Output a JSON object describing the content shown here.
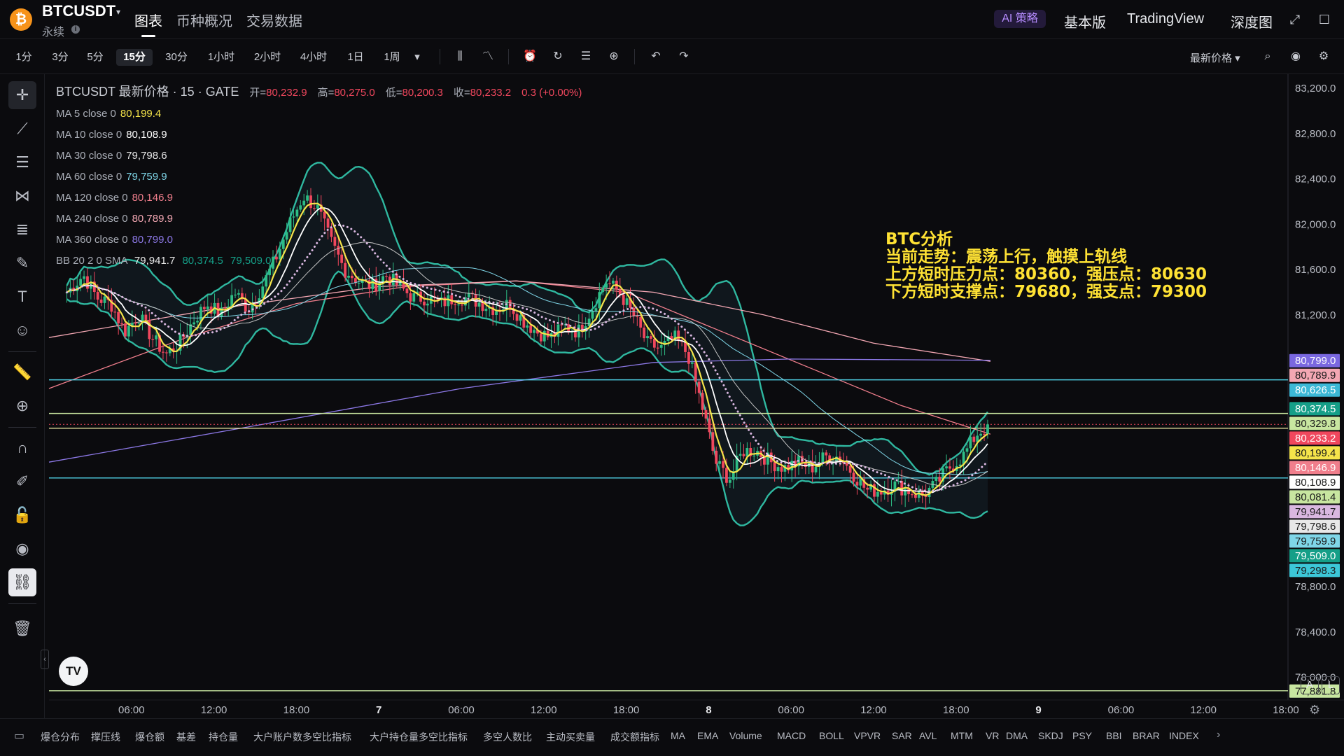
{
  "header": {
    "logo_glyph": "₿",
    "symbol": "BTCUSDT",
    "symbol_caret": "▾",
    "subtitle": "永续",
    "info_glyph": "i",
    "main_tabs": [
      "图表",
      "币种概况",
      "交易数据"
    ],
    "ai_badge": "AI 策略",
    "right_tabs": [
      "基本版",
      "TradingView",
      "深度图"
    ],
    "icons": [
      "expand-icon",
      "fullscreen-icon"
    ]
  },
  "toolbar": {
    "intervals": [
      "1分",
      "3分",
      "5分",
      "15分",
      "30分",
      "1小时",
      "2小时",
      "4小时",
      "1日",
      "1周"
    ],
    "active_interval": "15分",
    "dropdown_glyph": "▾",
    "price_mode": "最新价格 ▾",
    "icons": [
      "candle-type-icon",
      "indicators-icon",
      "alert-icon",
      "replay-icon",
      "templates-icon",
      "add-icon",
      "undo-icon",
      "redo-icon",
      "search-icon",
      "camera-icon",
      "settings-icon"
    ]
  },
  "rail": {
    "tools": [
      "crosshair-icon",
      "trendline-icon",
      "fib-icon",
      "pattern-icon",
      "gann-icon",
      "brush-icon",
      "text-icon",
      "emoji-icon",
      "ruler-icon",
      "zoom-icon",
      "magnet-icon",
      "draw-lock-icon",
      "lock-icon",
      "eye-icon",
      "link-icon",
      "trash-icon"
    ]
  },
  "legend": {
    "title": "BTCUSDT 最新价格 · 15 · GATE",
    "ohlc": [
      {
        "label": "开=",
        "value": "80,232.9"
      },
      {
        "label": "高=",
        "value": "80,275.0"
      },
      {
        "label": "低=",
        "value": "80,200.3"
      },
      {
        "label": "收=",
        "value": "80,233.2"
      }
    ],
    "change": "0.3 (+0.00%)",
    "ma": [
      {
        "label": "MA 5 close 0",
        "value": "80,199.4",
        "color": "#f5e44a"
      },
      {
        "label": "MA 10 close 0",
        "value": "80,108.9",
        "color": "#ffffff"
      },
      {
        "label": "MA 30 close 0",
        "value": "79,798.6",
        "color": "#e8e8e8"
      },
      {
        "label": "MA 60 close 0",
        "value": "79,759.9",
        "color": "#7fd6e8"
      },
      {
        "label": "MA 120 close 0",
        "value": "80,146.9",
        "color": "#f07e8c"
      },
      {
        "label": "MA 240 close 0",
        "value": "80,789.9",
        "color": "#f3a7b3"
      },
      {
        "label": "MA 360 close 0",
        "value": "80,799.0",
        "color": "#8c78e6"
      }
    ],
    "bb": {
      "label": "BB 20 2 0 SMA",
      "values": [
        "79,941.7",
        "80,374.5",
        "79,509.0"
      ]
    }
  },
  "annotation": {
    "lines": [
      "BTC分析",
      "当前走势：震荡上行，触摸上轨线",
      "上方短时压力点：80360，强压点：80630",
      "下方短时支撑点：79680，强支点：79300"
    ]
  },
  "chart_data": {
    "type": "candlestick",
    "title": "BTCUSDT 最新价格 · 15 · GATE",
    "ylim": [
      77800,
      83300
    ],
    "y_ticks": [
      83200,
      82800,
      82400,
      82000,
      81600,
      81200,
      80800,
      80400,
      80000,
      79600,
      79200,
      78800,
      78400,
      78000
    ],
    "y_tick_labels": [
      "83,200.0",
      "82,800.0",
      "82,400.0",
      "82,000.0",
      "81,600.0",
      "81,200.0",
      "80,800.0",
      "80,400.0",
      "80,000.0",
      "79,600.0",
      "79,200.0",
      "78,800.0",
      "78,400.0",
      "78,000.0"
    ],
    "x_ticks": [
      {
        "t": 6,
        "label": "06:00"
      },
      {
        "t": 12,
        "label": "12:00"
      },
      {
        "t": 18,
        "label": "18:00"
      },
      {
        "t": 24,
        "label": "7",
        "bold": true
      },
      {
        "t": 30,
        "label": "06:00"
      },
      {
        "t": 36,
        "label": "12:00"
      },
      {
        "t": 42,
        "label": "18:00"
      },
      {
        "t": 48,
        "label": "8",
        "bold": true
      },
      {
        "t": 54,
        "label": "06:00"
      },
      {
        "t": 60,
        "label": "12:00"
      },
      {
        "t": 66,
        "label": "18:00"
      },
      {
        "t": 72,
        "label": "9",
        "bold": true
      },
      {
        "t": 78,
        "label": "06:00"
      },
      {
        "t": 84,
        "label": "12:00"
      },
      {
        "t": 90,
        "label": "18:00"
      }
    ],
    "close_path": [
      [
        1.3,
        81400
      ],
      [
        2.5,
        81550
      ],
      [
        3.5,
        81350
      ],
      [
        4.5,
        81300
      ],
      [
        5.5,
        81050
      ],
      [
        6.5,
        81200
      ],
      [
        7.5,
        81000
      ],
      [
        8.5,
        80850
      ],
      [
        9.5,
        80950
      ],
      [
        10.5,
        81150
      ],
      [
        11.5,
        81300
      ],
      [
        12.5,
        81200
      ],
      [
        13.5,
        81400
      ],
      [
        14.5,
        81250
      ],
      [
        15.5,
        81450
      ],
      [
        16.5,
        81700
      ],
      [
        17.5,
        82000
      ],
      [
        18.5,
        82250
      ],
      [
        19.5,
        82150
      ],
      [
        20.5,
        81850
      ],
      [
        21.5,
        81600
      ],
      [
        22.5,
        81500
      ],
      [
        23.5,
        81450
      ],
      [
        24.5,
        81550
      ],
      [
        25.5,
        81450
      ],
      [
        26.5,
        81350
      ],
      [
        27.5,
        81350
      ],
      [
        28.5,
        81300
      ],
      [
        29.5,
        81350
      ],
      [
        30.5,
        81350
      ],
      [
        31.5,
        81300
      ],
      [
        32.5,
        81250
      ],
      [
        33.5,
        81300
      ],
      [
        34.5,
        81150
      ],
      [
        35.5,
        81050
      ],
      [
        36.5,
        81000
      ],
      [
        37.5,
        81100
      ],
      [
        38.5,
        81050
      ],
      [
        39.5,
        81250
      ],
      [
        40.5,
        81500
      ],
      [
        41.5,
        81400
      ],
      [
        42.5,
        81200
      ],
      [
        43.5,
        80950
      ],
      [
        44.5,
        80900
      ],
      [
        45.5,
        81000
      ],
      [
        46.5,
        80850
      ],
      [
        47.5,
        80400
      ],
      [
        48.5,
        79900
      ],
      [
        49.5,
        79750
      ],
      [
        50.5,
        80000
      ],
      [
        51.5,
        80000
      ],
      [
        52.5,
        79900
      ],
      [
        53.5,
        79850
      ],
      [
        54.5,
        79900
      ],
      [
        55.5,
        79850
      ],
      [
        56.5,
        79950
      ],
      [
        57.5,
        79950
      ],
      [
        58.5,
        79800
      ],
      [
        59.5,
        79650
      ],
      [
        60.5,
        79650
      ],
      [
        61.5,
        79700
      ],
      [
        62.5,
        79650
      ],
      [
        63.5,
        79600
      ],
      [
        64.5,
        79700
      ],
      [
        65.5,
        79850
      ],
      [
        66.5,
        79950
      ],
      [
        67.5,
        80150
      ],
      [
        68.5,
        80233
      ]
    ],
    "ma_lines": [
      {
        "name": "MA 5",
        "color": "#f5e44a",
        "width": 2.2,
        "smooth": 1
      },
      {
        "name": "MA 10",
        "color": "#ffffff",
        "width": 1.8,
        "smooth": 2
      },
      {
        "name": "MA 30",
        "color": "#c4c4c4",
        "width": 1.0,
        "smooth": 5
      },
      {
        "name": "MA 60",
        "color": "#7fd6e8",
        "width": 1.0,
        "smooth": 8
      }
    ],
    "ma_paths": [
      {
        "name": "MA 120",
        "color": "#f07e8c",
        "points": [
          [
            0,
            80550
          ],
          [
            10,
            81000
          ],
          [
            18,
            81300
          ],
          [
            26,
            81450
          ],
          [
            34,
            81500
          ],
          [
            42,
            81400
          ],
          [
            48,
            81100
          ],
          [
            56,
            80700
          ],
          [
            62,
            80400
          ],
          [
            68.5,
            80147
          ]
        ]
      },
      {
        "name": "MA 240",
        "color": "#f3a7b3",
        "points": [
          [
            0,
            81000
          ],
          [
            12,
            81250
          ],
          [
            24,
            81450
          ],
          [
            34,
            81500
          ],
          [
            44,
            81400
          ],
          [
            52,
            81200
          ],
          [
            60,
            80950
          ],
          [
            68.5,
            80790
          ]
        ]
      },
      {
        "name": "MA 360",
        "color": "#8c78e6",
        "points": [
          [
            0,
            79900
          ],
          [
            14,
            80200
          ],
          [
            30,
            80550
          ],
          [
            44,
            80780
          ],
          [
            54,
            80810
          ],
          [
            68.5,
            80799
          ]
        ]
      }
    ],
    "bollinger": {
      "name": "BB 20 2 0 SMA",
      "color": "#2fb8a0",
      "basis_color": "#d9b7e0",
      "values": [
        "79,941.7",
        "80,374.5",
        "79,509.0"
      ]
    },
    "horizontal_lines": [
      {
        "price": 80626.5,
        "color": "#4fd0e6"
      },
      {
        "price": 80329.8,
        "color": "#c8e6a0"
      },
      {
        "price": 80199.4,
        "color": "#e8e6a0"
      },
      {
        "price": 79759.9,
        "color": "#4fd0e6"
      },
      {
        "price": 77881.8,
        "color": "#c8e6a0"
      }
    ],
    "last_price_line": 80233.2,
    "price_labels": [
      {
        "price": 80799.0,
        "text": "80,799.0",
        "color": "#7a68e0",
        "fg": "#ffffff"
      },
      {
        "price": 80789.9,
        "text": "80,789.9",
        "color": "#f3a7b3",
        "fg": "#1a1a1a"
      },
      {
        "price": 80626.5,
        "text": "80,626.5",
        "color": "#3cb8d6",
        "fg": "#ffffff"
      },
      {
        "price": 80374.5,
        "text": "80,374.5",
        "color": "#159f88",
        "fg": "#ffffff"
      },
      {
        "price": 80329.8,
        "text": "80,329.8",
        "color": "#c8e6a0",
        "fg": "#1a1a1a"
      },
      {
        "price": 80233.2,
        "text": "80,233.2",
        "color": "#f0475d",
        "fg": "#ffffff"
      },
      {
        "price": 80199.4,
        "text": "80,199.4",
        "color": "#f5e44a",
        "fg": "#1a1a1a"
      },
      {
        "price": 80146.9,
        "text": "80,146.9",
        "color": "#f07e8c",
        "fg": "#ffffff"
      },
      {
        "price": 80108.9,
        "text": "80,108.9",
        "color": "#ffffff",
        "fg": "#1a1a1a"
      },
      {
        "price": 80081.4,
        "text": "80,081.4",
        "color": "#c8e6a0",
        "fg": "#1a1a1a"
      },
      {
        "price": 79941.7,
        "text": "79,941.7",
        "color": "#d9b7e0",
        "fg": "#1a1a1a"
      },
      {
        "price": 79798.6,
        "text": "79,798.6",
        "color": "#e8e8e8",
        "fg": "#1a1a1a"
      },
      {
        "price": 79759.9,
        "text": "79,759.9",
        "color": "#7fd6e8",
        "fg": "#1a1a1a"
      },
      {
        "price": 79509.0,
        "text": "79,509.0",
        "color": "#159f88",
        "fg": "#ffffff"
      },
      {
        "price": 79298.3,
        "text": "79,298.3",
        "color": "#3cc7d8",
        "fg": "#1a1a1a"
      },
      {
        "price": 77881.8,
        "text": "77,881.8",
        "color": "#c8e6a0",
        "fg": "#1a1a1a"
      }
    ],
    "colors": {
      "up": "#2ebd85",
      "down": "#f0475d"
    }
  },
  "chart_ui": {
    "tv_badge": "TV",
    "collapse_glyph": "‹",
    "corner_buttons": [
      "A",
      "L"
    ],
    "tz_glyph": "⚙"
  },
  "indicators": {
    "icon_glyph": "▭",
    "items": [
      "爆仓分布",
      "撑压线",
      "爆仓额",
      "基差",
      "持仓量",
      "大户账户数多空比指标",
      "大户持仓量多空比指标",
      "多空人数比",
      "主动买卖量",
      "成交额指标",
      "MA",
      "EMA",
      "Volume",
      "MACD",
      "BOLL",
      "VPVR",
      "SAR",
      "AVL",
      "MTM",
      "VR",
      "DMA",
      "SKDJ",
      "PSY",
      "BBI",
      "BRAR",
      "INDEX"
    ],
    "more_glyph": "›"
  }
}
